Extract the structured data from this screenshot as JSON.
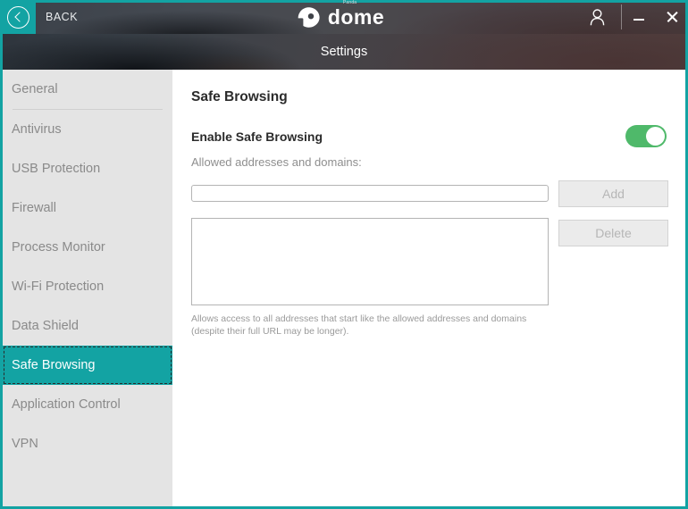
{
  "titlebar": {
    "back_label": "BACK",
    "back_icon": "chevron-left-circle-icon",
    "user_icon": "user-account-icon",
    "minimize_icon": "minimize-icon",
    "close_icon": "close-icon",
    "brand": {
      "word": "dome",
      "superscript": "Panda",
      "mark_icon": "panda-dome-logo-icon"
    },
    "accent_color": "#13a3a3"
  },
  "banner": {
    "title": "Settings"
  },
  "sidebar": {
    "items": [
      {
        "label": "General",
        "selected": false,
        "divider_after": true
      },
      {
        "label": "Antivirus",
        "selected": false,
        "divider_after": false
      },
      {
        "label": "USB Protection",
        "selected": false,
        "divider_after": false
      },
      {
        "label": "Firewall",
        "selected": false,
        "divider_after": false
      },
      {
        "label": "Process Monitor",
        "selected": false,
        "divider_after": false
      },
      {
        "label": "Wi-Fi Protection",
        "selected": false,
        "divider_after": false
      },
      {
        "label": "Data Shield",
        "selected": false,
        "divider_after": false
      },
      {
        "label": "Safe Browsing",
        "selected": true,
        "divider_after": false
      },
      {
        "label": "Application Control",
        "selected": false,
        "divider_after": false
      },
      {
        "label": "VPN",
        "selected": false,
        "divider_after": false
      }
    ],
    "selected_color": "#13a3a3",
    "background_color": "#e4e4e4"
  },
  "main": {
    "page_title": "Safe Browsing",
    "enable_label": "Enable Safe Browsing",
    "toggle": {
      "state": "on",
      "on_color": "#4fb96a"
    },
    "field_label": "Allowed addresses and domains:",
    "address_input": {
      "value": "",
      "placeholder": ""
    },
    "address_list": {
      "items": []
    },
    "add_button": {
      "label": "Add",
      "enabled": false
    },
    "delete_button": {
      "label": "Delete",
      "enabled": false
    },
    "help_text": "Allows access to all addresses that start like the allowed addresses and domains (despite their full URL may be longer)."
  }
}
